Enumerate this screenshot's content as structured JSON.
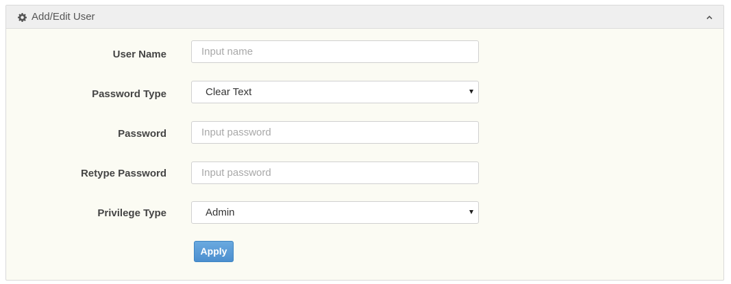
{
  "panel": {
    "title": "Add/Edit User",
    "header_icon": "gear-icon",
    "collapse_icon": "chevron-up-icon"
  },
  "form": {
    "user_name": {
      "label": "User Name",
      "placeholder": "Input name",
      "value": ""
    },
    "password_type": {
      "label": "Password Type",
      "selected": "Clear Text"
    },
    "password": {
      "label": "Password",
      "placeholder": "Input password",
      "value": ""
    },
    "retype_password": {
      "label": "Retype Password",
      "placeholder": "Input password",
      "value": ""
    },
    "privilege_type": {
      "label": "Privilege Type",
      "selected": "Admin"
    },
    "apply_label": "Apply"
  },
  "colors": {
    "panel_background": "#fbfbf3",
    "header_background": "#efefef",
    "apply_button": "#5b9bd5"
  }
}
